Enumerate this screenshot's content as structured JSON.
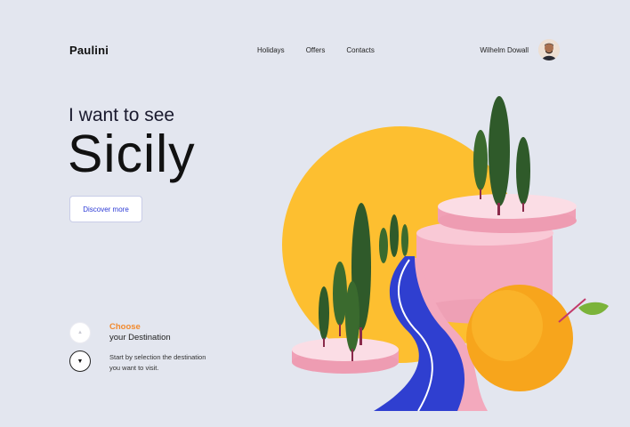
{
  "brand": {
    "logo": "Paulini"
  },
  "nav": {
    "items": [
      "Holidays",
      "Offers",
      "Contacts"
    ]
  },
  "user": {
    "name": "Wilhelm Dowall"
  },
  "hero": {
    "line1": "I want to see",
    "line2": "Sicily",
    "cta": "Discover more"
  },
  "steps": {
    "up_icon": "chevron-up-icon",
    "down_icon": "chevron-down-icon",
    "title_accent": "Choose",
    "title_rest": "your Destination",
    "description": "Start by selection the destination you want to visit."
  },
  "colors": {
    "background": "#e3e6ef",
    "accent_orange": "#f28a2e",
    "link_blue": "#2d3bd6",
    "sun": "#fdbf30",
    "pink": "#f3a9bd",
    "road": "#2f3fd0",
    "tree": "#2f5a2a"
  }
}
